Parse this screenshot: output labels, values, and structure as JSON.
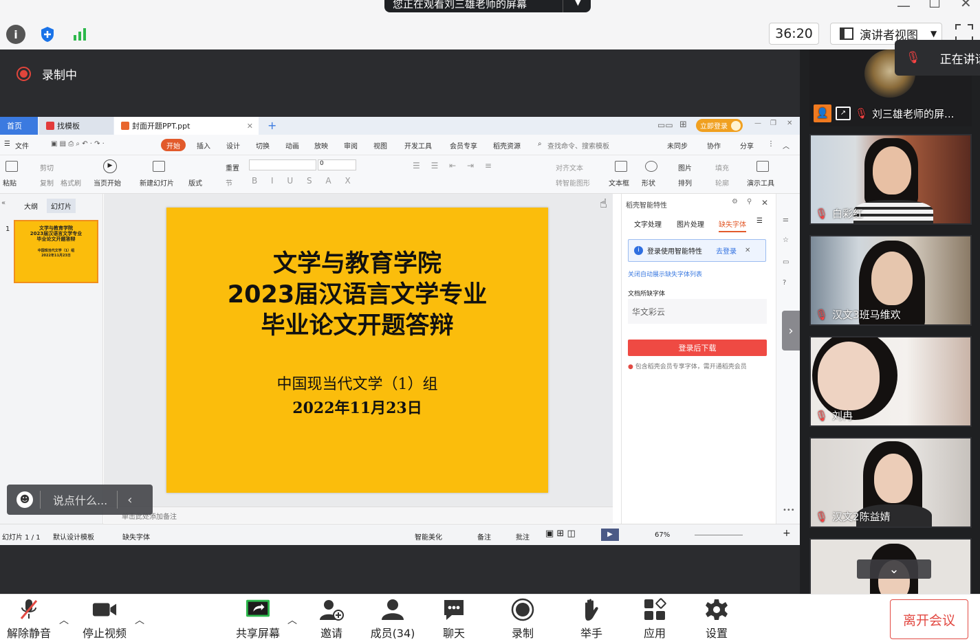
{
  "colors": {
    "accent_red": "#e24a43",
    "slide_yellow": "#fbbd0c",
    "wps_blue": "#3b7ae0",
    "share_bg": "#2b2c2f"
  },
  "meeting": {
    "share_banner": "您正在观看刘三雄老师的屏幕",
    "timer": "36:20",
    "view_mode": "演讲者视图",
    "recording_label": "录制中",
    "speaking_label": "正在讲话",
    "chat_placeholder": "说点什么..."
  },
  "wps": {
    "tabs": [
      "首页",
      "找模板",
      "封面开题PPT.ppt"
    ],
    "login_pill": "立即登录",
    "menu": [
      "文件",
      "开始",
      "插入",
      "设计",
      "切换",
      "动画",
      "放映",
      "审阅",
      "视图",
      "开发工具",
      "会员专享",
      "稻壳资源"
    ],
    "search_hint": "查找命令、搜索模板",
    "sync": [
      "未同步",
      "协作",
      "分享"
    ],
    "ribbon": {
      "paste": "粘贴",
      "cut": "剪切",
      "copy": "复制",
      "format_painter": "格式刷",
      "from_current": "当页开始",
      "new_slide": "新建幻灯片",
      "layout": "版式",
      "section": "节",
      "reset": "重置",
      "font_size": "0",
      "align_text": "对齐文本",
      "smart_shape": "转智能图形",
      "textbox": "文本框",
      "shape": "形状",
      "picture": "图片",
      "arrange": "排列",
      "fill": "填充",
      "outline": "轮廓",
      "present_tools": "演示工具"
    },
    "thumb_tabs": [
      "大纲",
      "幻灯片"
    ],
    "thumb_number": "1",
    "thumb_title": "文学与教育学院\n2023届汉语言文学专业\n毕业论文开题答辩",
    "thumb_sub": "中国现当代文学（1）组\n2022年11月23日",
    "notes_placeholder": "单击此处添加备注",
    "status": {
      "slide_count": "幻灯片 1 / 1",
      "template": "默认设计模板",
      "missing_font": "缺失字体",
      "beautify": "智能美化",
      "notes": "备注",
      "comments": "批注",
      "zoom": "67%"
    }
  },
  "slide": {
    "title_line1": "文学与教育学院",
    "title_line2": "2023届汉语言文学专业",
    "title_line3": "毕业论文开题答辩",
    "group": "中国现当代文学（1）组",
    "date": "2022年11月23日"
  },
  "smart_panel": {
    "header": "稻壳智能特性",
    "tabs": [
      "文字处理",
      "图片处理",
      "缺失字体"
    ],
    "login_notice": "登录使用智能特性",
    "go_login": "去登录",
    "auto_show_link": "关闭自动展示缺失字体列表",
    "missing_label": "文档所缺字体",
    "missing_font": "华文彩云",
    "download_btn": "登录后下载",
    "member_note": "包含稻壳会员专享字体，需开通稻壳会员"
  },
  "participants": [
    {
      "name": "刘三雄老师的屏..."
    },
    {
      "name": "白彩红"
    },
    {
      "name": "汉文3班马维欢"
    },
    {
      "name": "刘冉"
    },
    {
      "name": "汉文2陈益婧"
    }
  ],
  "toolbar": {
    "unmute": "解除静音",
    "stop_video": "停止视频",
    "share_screen": "共享屏幕",
    "invite": "邀请",
    "members": "成员(34)",
    "chat": "聊天",
    "record": "录制",
    "raise_hand": "举手",
    "apps": "应用",
    "settings": "设置",
    "leave": "离开会议"
  }
}
